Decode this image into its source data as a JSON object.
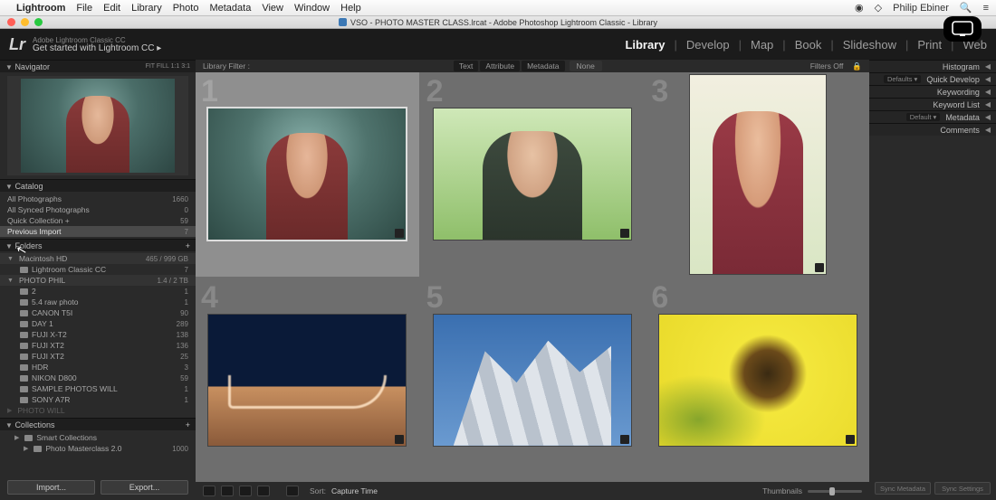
{
  "menubar": {
    "app": "Lightroom",
    "items": [
      "File",
      "Edit",
      "Library",
      "Photo",
      "Metadata",
      "View",
      "Window",
      "Help"
    ],
    "user": "Philip Ebiner"
  },
  "window": {
    "title": "VSO - PHOTO MASTER CLASS.lrcat - Adobe Photoshop Lightroom Classic - Library"
  },
  "header": {
    "lr": "Lr",
    "edition": "Adobe Lightroom Classic CC",
    "subtitle": "Get started with Lightroom CC  ▸",
    "modules": [
      "Library",
      "Develop",
      "Map",
      "Book",
      "Slideshow",
      "Print",
      "Web"
    ],
    "active_module": "Library"
  },
  "left": {
    "navigator": {
      "title": "Navigator",
      "modes": "FIT   FILL   1:1   3:1"
    },
    "catalog": {
      "title": "Catalog",
      "items": [
        {
          "label": "All Photographs",
          "count": "1660"
        },
        {
          "label": "All Synced Photographs",
          "count": "0"
        },
        {
          "label": "Quick Collection  +",
          "count": "59"
        },
        {
          "label": "Previous Import",
          "count": "7"
        }
      ],
      "selected": 3
    },
    "folders": {
      "title": "Folders",
      "volumes": [
        {
          "label": "Macintosh HD",
          "meta": "465 / 999 GB"
        },
        {
          "label": "PHOTO PHIL",
          "meta": "1.4 / 2 TB"
        }
      ],
      "v0": [
        {
          "label": "Lightroom Classic CC",
          "count": "7"
        }
      ],
      "v1": [
        {
          "label": "2",
          "count": "1"
        },
        {
          "label": "5.4 raw photo",
          "count": "1"
        },
        {
          "label": "CANON T5I",
          "count": "90"
        },
        {
          "label": "DAY 1",
          "count": "289"
        },
        {
          "label": "FUJI X-T2",
          "count": "138"
        },
        {
          "label": "FUJI XT2",
          "count": "136"
        },
        {
          "label": "FUJI XT2",
          "count": "25"
        },
        {
          "label": "HDR",
          "count": "3"
        },
        {
          "label": "NIKON D800",
          "count": "59"
        },
        {
          "label": "SAMPLE PHOTOS WILL",
          "count": "1"
        },
        {
          "label": "SONY A7R",
          "count": "1"
        }
      ],
      "dim": "PHOTO WILL"
    },
    "collections": {
      "title": "Collections",
      "items": [
        {
          "label": "Smart Collections",
          "count": ""
        },
        {
          "label": "Photo Masterclass 2.0",
          "count": "1000"
        }
      ]
    },
    "buttons": {
      "import": "Import...",
      "export": "Export..."
    }
  },
  "filter": {
    "label": "Library Filter :",
    "tabs": [
      "Text",
      "Attribute",
      "Metadata"
    ],
    "none": "None",
    "off": "Filters Off"
  },
  "grid_numbers": [
    "1",
    "2",
    "3",
    "4",
    "5",
    "6"
  ],
  "toolbar": {
    "sort_label": "Sort:",
    "sort_value": "Capture Time",
    "thumb_label": "Thumbnails"
  },
  "right": {
    "panels": [
      {
        "label": "Histogram"
      },
      {
        "label": "Quick Develop",
        "dd": "Defaults"
      },
      {
        "label": "Keywording"
      },
      {
        "label": "Keyword List"
      },
      {
        "label": "Metadata",
        "dd": "Default"
      },
      {
        "label": "Comments"
      }
    ],
    "btn1": "Sync Metadata",
    "btn2": "Sync Settings"
  }
}
